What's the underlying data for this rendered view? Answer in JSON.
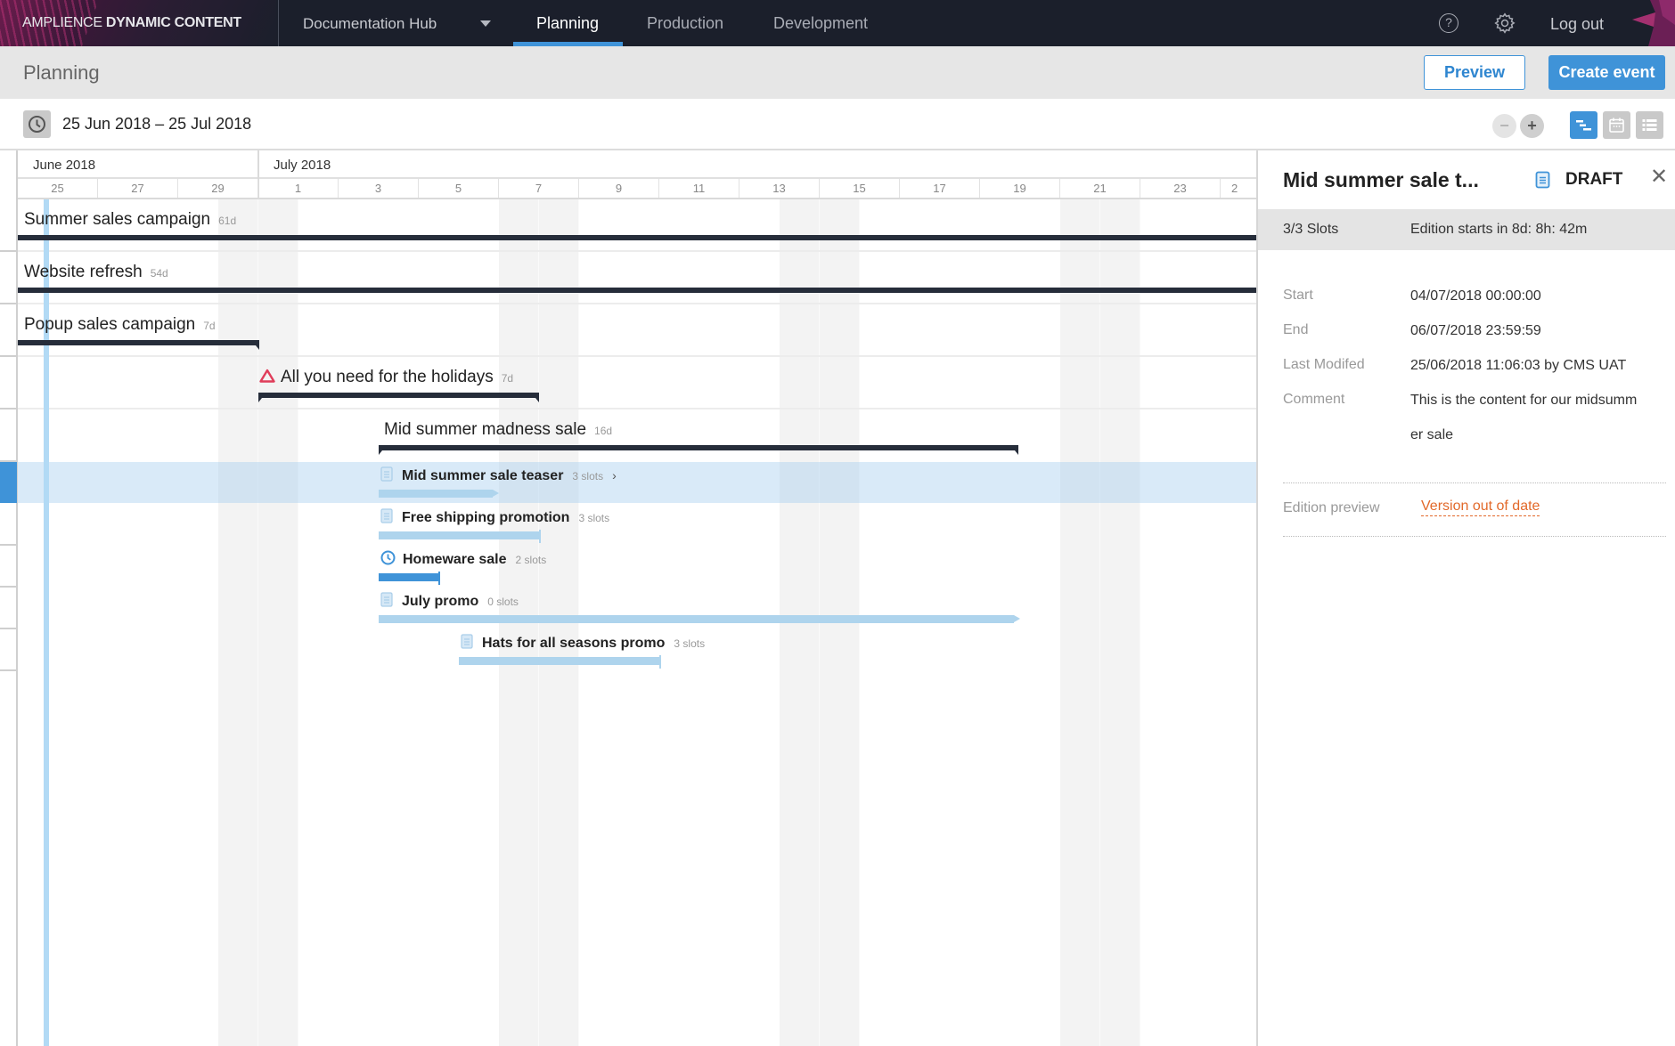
{
  "topnav": {
    "brand_light": "AMPLIENCE ",
    "brand_bold": "DYNAMIC CONTENT",
    "hub": "Documentation Hub",
    "tabs": [
      {
        "label": "Planning",
        "active": true
      },
      {
        "label": "Production",
        "active": false
      },
      {
        "label": "Development",
        "active": false
      }
    ],
    "help_icon": "?",
    "logout": "Log out",
    "accent": "#3f93d8"
  },
  "subheader": {
    "title": "Planning",
    "preview_label": "Preview",
    "create_label": "Create event"
  },
  "toolbar": {
    "date_range": "25 Jun 2018 – 25 Jul 2018",
    "zoom_out": "−",
    "zoom_in": "+",
    "views": [
      "timeline",
      "calendar",
      "list"
    ],
    "active_view": "timeline"
  },
  "timeline": {
    "months": [
      {
        "label": "June 2018"
      },
      {
        "label": "July 2018"
      }
    ],
    "day_ticks": [
      "25",
      "27",
      "29",
      "1",
      "3",
      "5",
      "7",
      "9",
      "11",
      "13",
      "15",
      "17",
      "19",
      "21",
      "23",
      "2"
    ],
    "events": [
      {
        "name": "Summer sales campaign",
        "duration": "61d"
      },
      {
        "name": "Website refresh",
        "duration": "54d"
      },
      {
        "name": "Popup sales campaign",
        "duration": "7d"
      },
      {
        "name": "All you need for the holidays",
        "duration": "7d",
        "warning": true
      },
      {
        "name": "Mid summer madness sale",
        "duration": "16d"
      }
    ],
    "editions": [
      {
        "name": "Mid summer sale teaser",
        "slots": "3 slots",
        "status": "draft",
        "selected": true
      },
      {
        "name": "Free shipping promotion",
        "slots": "3 slots",
        "status": "draft"
      },
      {
        "name": "Homeware sale",
        "slots": "2 slots",
        "status": "scheduled"
      },
      {
        "name": "July promo",
        "slots": "0 slots",
        "status": "draft"
      },
      {
        "name": "Hats for all seasons promo",
        "slots": "3 slots",
        "status": "draft"
      }
    ]
  },
  "panel": {
    "title": "Mid summer sale t...",
    "status": "DRAFT",
    "slots": "3/3 Slots",
    "countdown": "Edition starts in 8d: 8h: 42m",
    "props": [
      {
        "label": "Start",
        "value": "04/07/2018 00:00:00"
      },
      {
        "label": "End",
        "value": "06/07/2018 23:59:59"
      },
      {
        "label": "Last Modifed",
        "value": "25/06/2018 11:06:03 by CMS UAT"
      },
      {
        "label": "Comment",
        "value": "This is the content for our midsummer sale"
      }
    ],
    "preview_label": "Edition preview",
    "preview_value": "Version out of date",
    "warning_color": "#e2692a"
  }
}
